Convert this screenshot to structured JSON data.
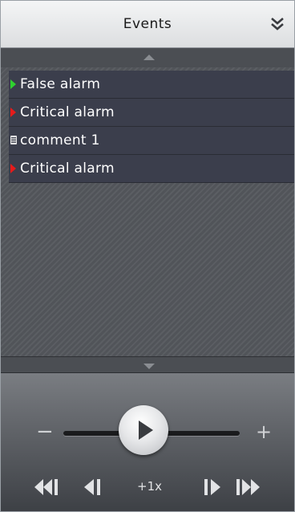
{
  "header": {
    "title": "Events",
    "collapse_icon": "double-chevron-down-icon"
  },
  "events": [
    {
      "label": "False alarm",
      "type": "false-alarm",
      "marker": "triangle",
      "color": "#2fd12f"
    },
    {
      "label": "Critical alarm",
      "type": "critical-alarm",
      "marker": "triangle",
      "color": "#e51b1b"
    },
    {
      "label": "comment 1",
      "type": "comment",
      "marker": "comment-icon",
      "color": "#e8e8e8"
    },
    {
      "label": "Critical alarm",
      "type": "critical-alarm",
      "marker": "triangle",
      "color": "#e51b1b"
    }
  ],
  "player": {
    "minus": "−",
    "plus": "+",
    "speed": "+1x",
    "controls": [
      "skip-to-start-icon",
      "step-back-icon",
      "step-forward-icon",
      "skip-to-end-icon"
    ],
    "play_icon": "play-icon"
  },
  "colors": {
    "accent_green": "#2fd12f",
    "accent_red": "#e51b1b",
    "row_bg": "#3b3e4c"
  }
}
